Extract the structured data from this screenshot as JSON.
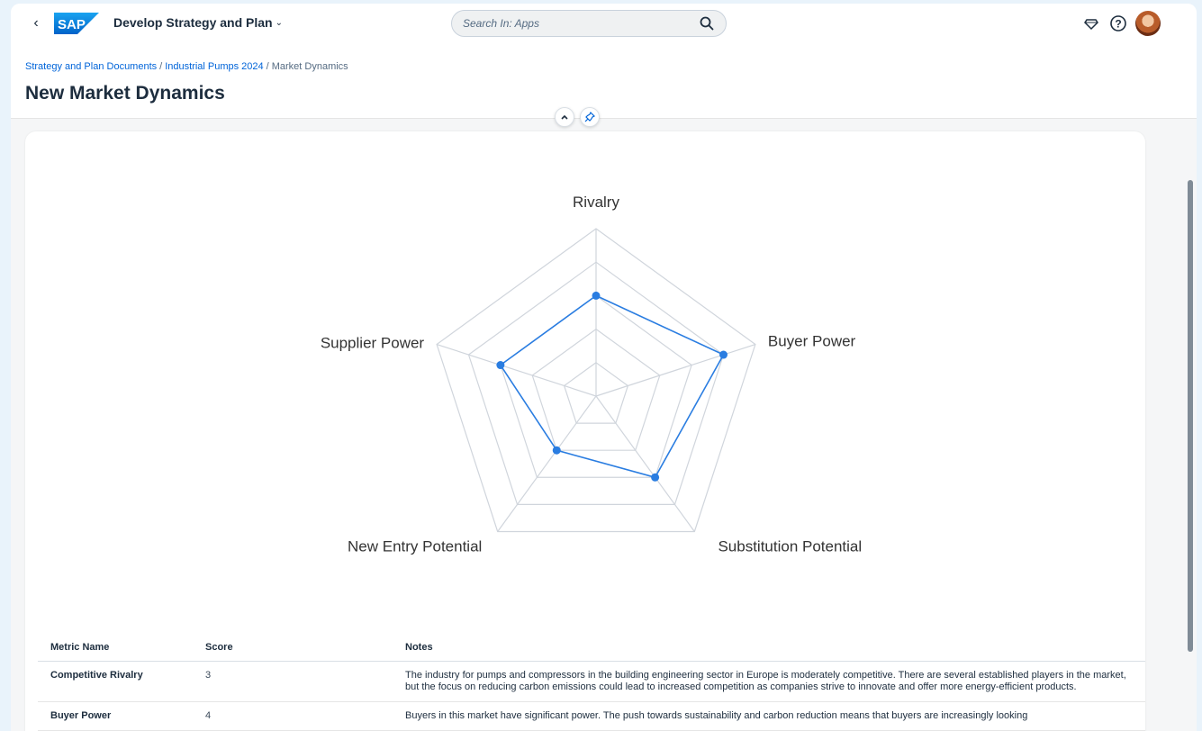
{
  "shellbar": {
    "logo_text": "SAP",
    "app_title": "Develop Strategy and Plan",
    "search_placeholder": "Search In: Apps",
    "icons": [
      "back-icon",
      "chevron-down-icon",
      "search-icon",
      "diamond-icon",
      "help-icon",
      "avatar"
    ]
  },
  "breadcrumb": {
    "items": [
      "Strategy and Plan Documents",
      "Industrial Pumps 2024"
    ],
    "current": "Market Dynamics"
  },
  "page": {
    "title": "New Market Dynamics"
  },
  "header_toggles": {
    "icons": [
      "collapse-icon",
      "pin-icon"
    ]
  },
  "chart_data": {
    "type": "radar",
    "axes": [
      "Rivalry",
      "Buyer Power",
      "Substitution Potential",
      "New Entry Potential",
      "Supplier Power"
    ],
    "values": [
      3,
      4,
      3,
      2,
      3
    ],
    "rmax": 5,
    "levels": 5,
    "colors": {
      "series": "#2a7de1",
      "grid": "#d0d5dc"
    }
  },
  "table": {
    "headers": [
      "Metric Name",
      "Score",
      "Notes"
    ],
    "rows": [
      {
        "name": "Competitive Rivalry",
        "score": "3",
        "notes": "The industry for pumps and compressors in the building engineering sector in Europe is moderately competitive. There are several established players in the market, but the focus on reducing carbon emissions could lead to increased competition as companies strive to innovate and offer more energy-efficient products."
      },
      {
        "name": "Buyer Power",
        "score": "4",
        "notes": "Buyers in this market have significant power. The push towards sustainability and carbon reduction means that buyers are increasingly looking"
      }
    ]
  }
}
